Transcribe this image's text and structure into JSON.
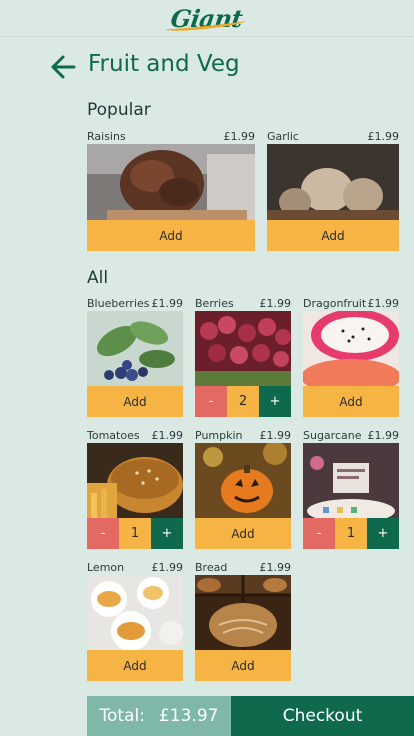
{
  "header": {
    "logo_text": "Giant"
  },
  "page": {
    "title": "Fruit and Veg"
  },
  "sections": {
    "popular": "Popular",
    "all": "All"
  },
  "add_label": "Add",
  "popular": [
    {
      "name": "Raisins",
      "price": "£1.99",
      "action": "add"
    },
    {
      "name": "Garlic",
      "price": "£1.99",
      "action": "add"
    }
  ],
  "all": [
    {
      "name": "Blueberries",
      "price": "£1.99",
      "action": "add"
    },
    {
      "name": "Berries",
      "price": "£1.99",
      "action": "stepper",
      "qty": "2",
      "minus": "-",
      "plus": "+"
    },
    {
      "name": "Dragonfruit",
      "price": "£1.99",
      "action": "add"
    },
    {
      "name": "Tomatoes",
      "price": "£1.99",
      "action": "stepper",
      "qty": "1",
      "minus": "-",
      "plus": "+"
    },
    {
      "name": "Pumpkin",
      "price": "£1.99",
      "action": "add"
    },
    {
      "name": "Sugarcane",
      "price": "£1.99",
      "action": "stepper",
      "qty": "1",
      "minus": "-",
      "plus": "+"
    },
    {
      "name": "Lemon",
      "price": "£1.99",
      "action": "add"
    },
    {
      "name": "Bread",
      "price": "£1.99",
      "action": "add"
    }
  ],
  "footer": {
    "total_label": "Total:",
    "total_value": "£13.97",
    "checkout_label": "Checkout"
  },
  "colors": {
    "brand": "#0f6a4d",
    "add": "#f6b444",
    "minus": "#e36a63",
    "total_bg": "#7fb8a8",
    "background": "#dbe9e5"
  }
}
